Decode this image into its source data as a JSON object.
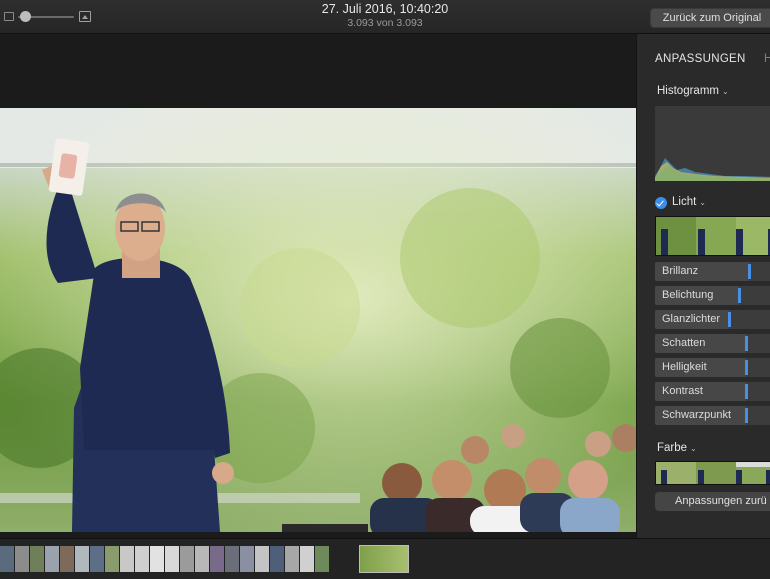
{
  "toolbar": {
    "date_time": "27. Juli 2016, 10:40:20",
    "photo_count": "3.093 von 3.093",
    "revert_label": "Zurück zum Original",
    "zoom_level": 0.08
  },
  "panel": {
    "tabs": [
      {
        "label": "ANPASSUNGEN",
        "active": true
      },
      {
        "label": "H",
        "active": false
      }
    ],
    "histogram_label": "Histogramm",
    "light": {
      "label": "Licht",
      "enabled": true,
      "sliders": [
        {
          "label": "Brillanz",
          "value": 0.78
        },
        {
          "label": "Belichtung",
          "value": 0.7
        },
        {
          "label": "Glanzlichter",
          "value": 0.62
        },
        {
          "label": "Schatten",
          "value": 0.76
        },
        {
          "label": "Helligkeit",
          "value": 0.76
        },
        {
          "label": "Kontrast",
          "value": 0.76
        },
        {
          "label": "Schwarzpunkt",
          "value": 0.76
        }
      ]
    },
    "color": {
      "label": "Farbe"
    },
    "reset_label": "Anpassungen zurü"
  },
  "colors": {
    "accent": "#3b8eea",
    "background": "#1e1e1e",
    "panel": "#2a2a2a"
  }
}
